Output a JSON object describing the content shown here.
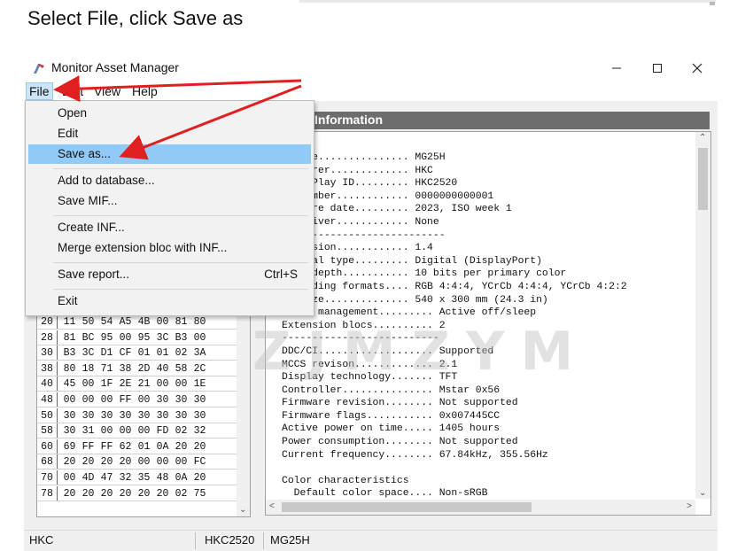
{
  "instruction": "Select File, click Save as",
  "window": {
    "title": "Monitor Asset Manager",
    "controls": [
      "minimize",
      "maximize",
      "close"
    ],
    "icons": {
      "minimize": "minimize-icon",
      "maximize": "maximize-icon",
      "close": "close-icon"
    }
  },
  "menubar": {
    "file": "File",
    "edit": "Edit",
    "view": "View",
    "help": "Help"
  },
  "file_menu": {
    "open": "Open",
    "edit": "Edit",
    "save_as": "Save as...",
    "add_to_database": "Add to database...",
    "save_mif": "Save MIF...",
    "create_inf": "Create INF...",
    "merge_inf": "Merge extension bloc with INF...",
    "save_report": "Save report...",
    "save_report_shortcut": "Ctrl+S",
    "exit": "Exit"
  },
  "hex_table": {
    "partial_row": [
      "10",
      "50",
      "10",
      "9?",
      "01",
      "4?",
      "9?",
      "20"
    ],
    "rows": [
      {
        "addr": "20",
        "cells": [
          "11",
          "50",
          "54",
          "A5",
          "4B",
          "00",
          "81",
          "80"
        ]
      },
      {
        "addr": "28",
        "cells": [
          "81",
          "BC",
          "95",
          "00",
          "95",
          "3C",
          "B3",
          "00"
        ]
      },
      {
        "addr": "30",
        "cells": [
          "B3",
          "3C",
          "D1",
          "CF",
          "01",
          "01",
          "02",
          "3A"
        ]
      },
      {
        "addr": "38",
        "cells": [
          "80",
          "18",
          "71",
          "38",
          "2D",
          "40",
          "58",
          "2C"
        ]
      },
      {
        "addr": "40",
        "cells": [
          "45",
          "00",
          "1F",
          "2E",
          "21",
          "00",
          "00",
          "1E"
        ]
      },
      {
        "addr": "48",
        "cells": [
          "00",
          "00",
          "00",
          "FF",
          "00",
          "30",
          "30",
          "30"
        ]
      },
      {
        "addr": "50",
        "cells": [
          "30",
          "30",
          "30",
          "30",
          "30",
          "30",
          "30",
          "30"
        ]
      },
      {
        "addr": "58",
        "cells": [
          "30",
          "31",
          "00",
          "00",
          "00",
          "FD",
          "02",
          "32"
        ]
      },
      {
        "addr": "60",
        "cells": [
          "69",
          "FF",
          "FF",
          "62",
          "01",
          "0A",
          "20",
          "20"
        ]
      },
      {
        "addr": "68",
        "cells": [
          "20",
          "20",
          "20",
          "20",
          "00",
          "00",
          "00",
          "FC"
        ]
      },
      {
        "addr": "70",
        "cells": [
          "00",
          "4D",
          "47",
          "32",
          "35",
          "48",
          "0A",
          "20"
        ]
      },
      {
        "addr": "78",
        "cells": [
          "20",
          "20",
          "20",
          "20",
          "20",
          "20",
          "02",
          "75"
        ]
      }
    ]
  },
  "info_panel": {
    "header": "Information",
    "body": "  name............... MG25H\nfacturer............. HKC\n and Play ID......... HKC2520\n l number............ 0000000000001\nfacture date......... 2023, ISO week 1\n r driver............ None\n---------------------------\n revision............ 1.4\n signal type......... Digital (DisplayPort)\n bit depth........... 10 bits per primary color\n encoding formats.... RGB 4:4:4, YCrCb 4:4:4, YCrCb 4:2:2\n n size.............. 540 x 300 mm (24.3 in)\nPower management......... Active off/sleep\nExtension blocs.......... 2\n--------------------------\nDDC/CI................... Supported\nMCCS revison............. 2.1\nDisplay technology....... TFT\nController............... Mstar 0x56\nFirmware revision........ Not supported\nFirmware flags........... 0x007445CC\nActive power on time..... 1405 hours\nPower consumption........ Not supported\nCurrent frequency........ 67.84kHz, 355.56Hz\n\nColor characteristics\n  Default color space.... Non-sRGB"
  },
  "statusbar": {
    "manufacturer": "HKC",
    "pnp_id": "HKC2520",
    "model": "MG25H"
  },
  "watermark": "ZJMZYM",
  "annotation_color": "#e02020"
}
